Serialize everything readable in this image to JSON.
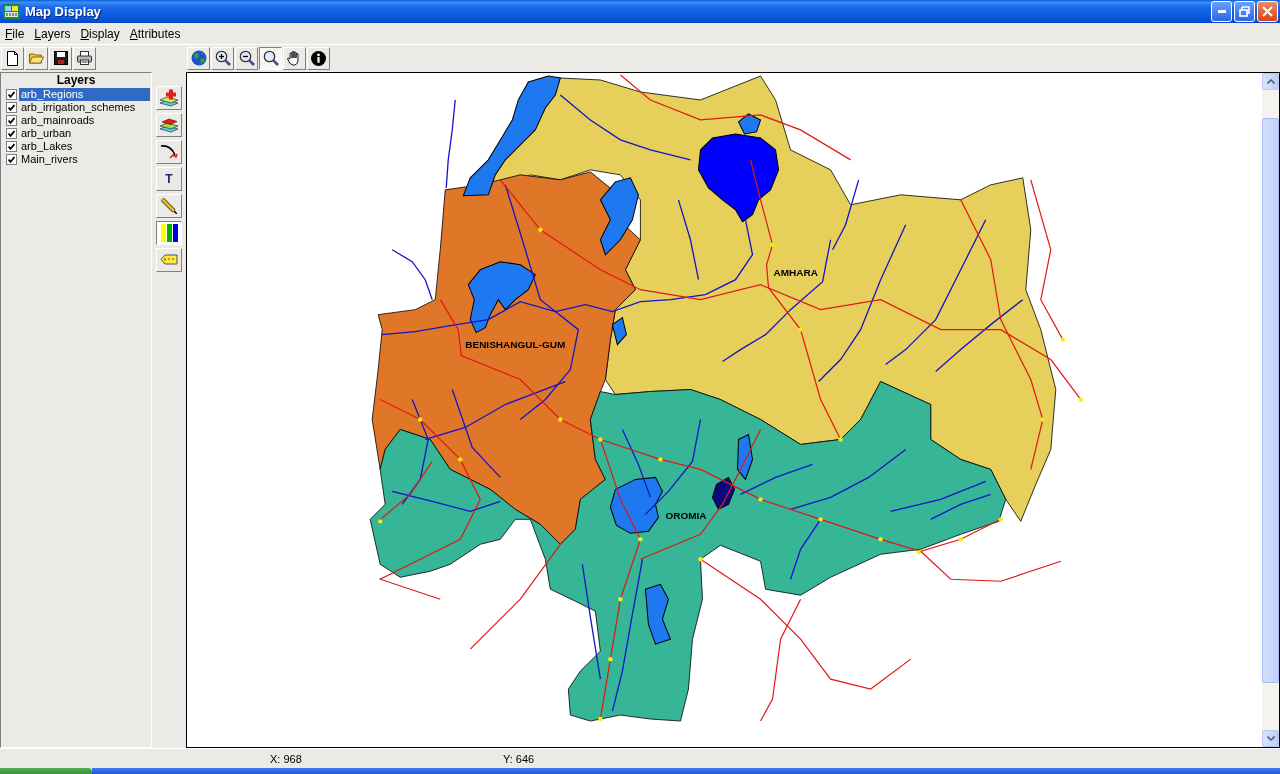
{
  "window": {
    "title": "Map Display"
  },
  "menu": [
    "File",
    "Layers",
    "Display",
    "Attributes"
  ],
  "file_tools": [
    {
      "kind": "new"
    },
    {
      "kind": "open"
    },
    {
      "kind": "save"
    },
    {
      "kind": "print"
    }
  ],
  "map_tools": [
    {
      "kind": "globe",
      "selected": false
    },
    {
      "kind": "zoom_in",
      "selected": false
    },
    {
      "kind": "zoom_out",
      "selected": false
    },
    {
      "kind": "zoom",
      "selected": true
    },
    {
      "kind": "pan",
      "selected": false
    },
    {
      "kind": "info",
      "selected": false
    }
  ],
  "layers_panel": {
    "title": "Layers",
    "layers": [
      {
        "name": "arb_Regions",
        "checked": true,
        "selected": true
      },
      {
        "name": "arb_irrigation_schemes",
        "checked": true,
        "selected": false
      },
      {
        "name": "arb_mainroads",
        "checked": true,
        "selected": false
      },
      {
        "name": "arb_urban",
        "checked": true,
        "selected": false
      },
      {
        "name": "arb_Lakes",
        "checked": true,
        "selected": false
      },
      {
        "name": "Main_rivers",
        "checked": true,
        "selected": false
      }
    ]
  },
  "layer_tools": [
    {
      "kind": "add_layer",
      "selected": false
    },
    {
      "kind": "remove_layer",
      "selected": false
    },
    {
      "kind": "line",
      "selected": false
    },
    {
      "kind": "text",
      "label": "T",
      "selected": false
    },
    {
      "kind": "pencil",
      "selected": false
    },
    {
      "kind": "legend",
      "selected": true
    },
    {
      "kind": "label",
      "selected": false
    }
  ],
  "map": {
    "regions": [
      {
        "label": "AMHARA",
        "color": "#e6cf5a"
      },
      {
        "label": "BENISHANGUL-GUM",
        "color": "#e07628"
      },
      {
        "label": "OROMIA",
        "color": "#36b597"
      }
    ]
  },
  "status_bar": {
    "x": "X: 968",
    "y": "Y: 646"
  }
}
